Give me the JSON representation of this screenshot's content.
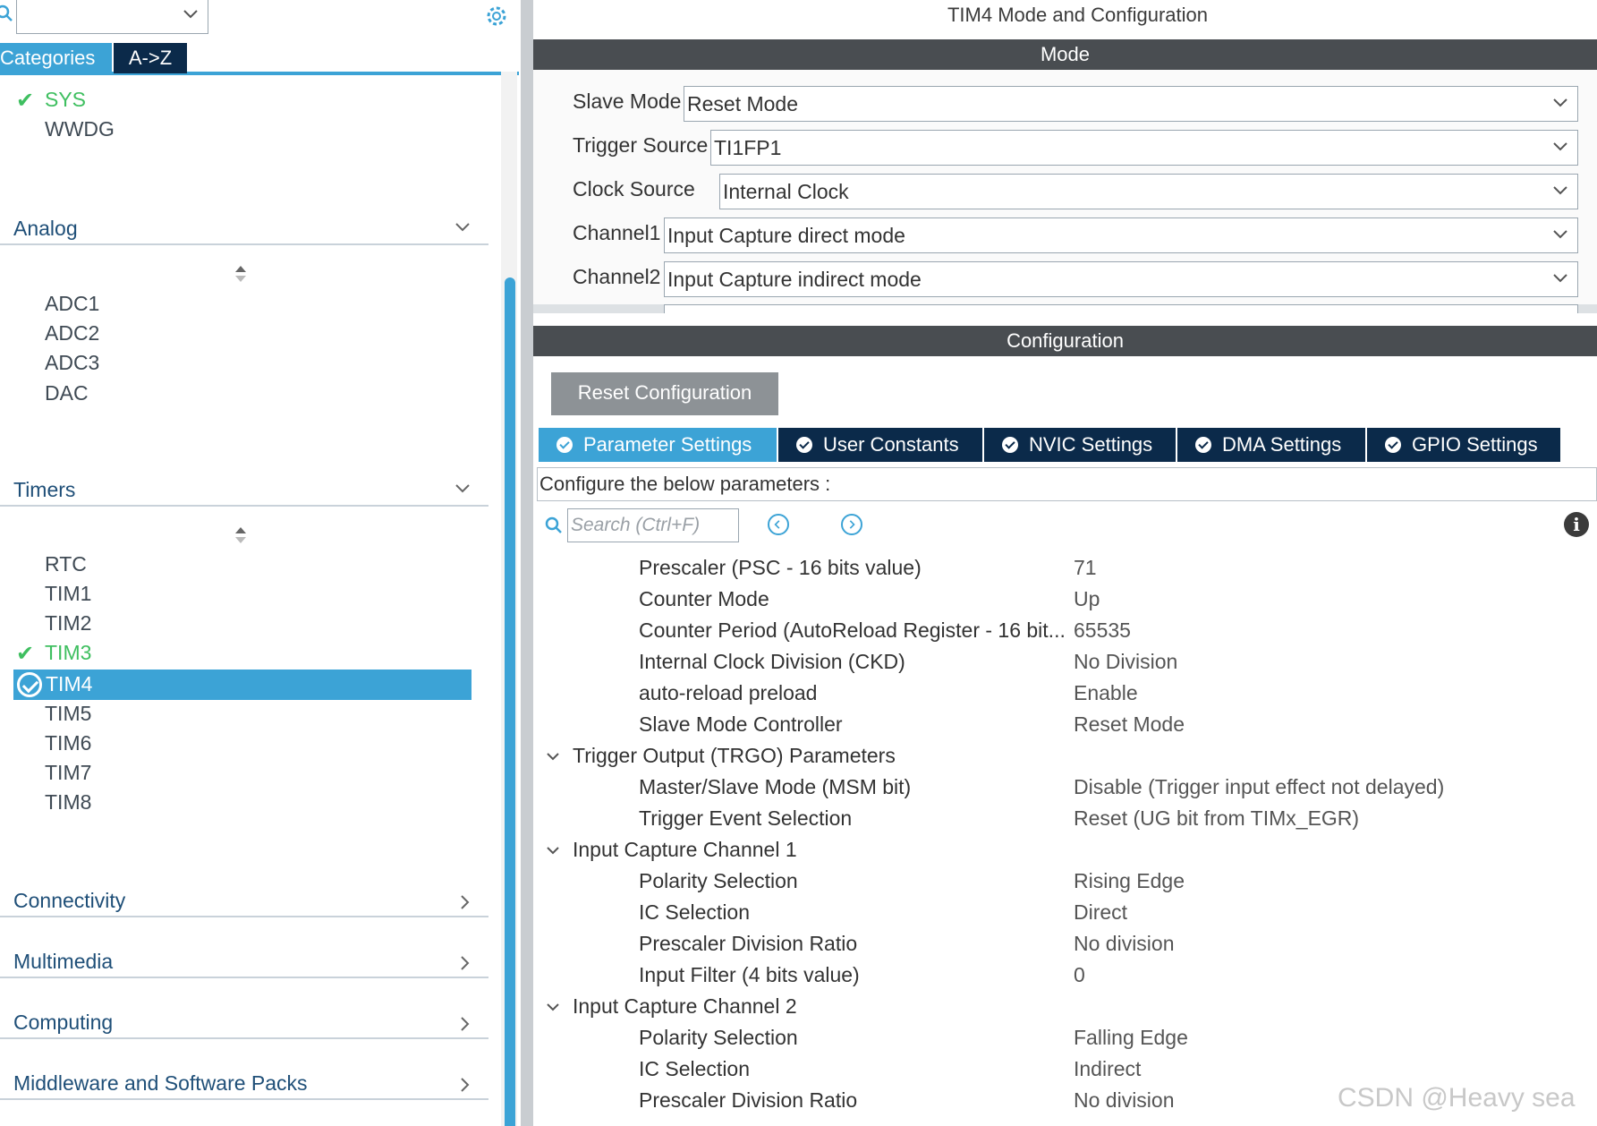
{
  "left": {
    "tabs": {
      "categories": "Categories",
      "az": "A->Z"
    },
    "system_items": [
      "SYS",
      "WWDG"
    ],
    "analog": {
      "title": "Analog",
      "items": [
        "ADC1",
        "ADC2",
        "ADC3",
        "DAC"
      ]
    },
    "timers": {
      "title": "Timers",
      "items": [
        "RTC",
        "TIM1",
        "TIM2",
        "TIM3",
        "TIM4",
        "TIM5",
        "TIM6",
        "TIM7",
        "TIM8"
      ],
      "selected": "TIM4"
    },
    "groups": [
      "Connectivity",
      "Multimedia",
      "Computing",
      "Middleware and Software Packs"
    ]
  },
  "right": {
    "title": "TIM4 Mode and Configuration",
    "mode_header": "Mode",
    "mode_rows": [
      {
        "label": "Slave Mode",
        "value": "Reset Mode"
      },
      {
        "label": "Trigger Source",
        "value": "TI1FP1"
      },
      {
        "label": "Clock Source",
        "value": "Internal Clock"
      },
      {
        "label": "Channel1",
        "value": "Input Capture direct mode"
      },
      {
        "label": "Channel2",
        "value": "Input Capture indirect mode"
      }
    ],
    "config_header": "Configuration",
    "reset_button": "Reset Configuration",
    "tabs": [
      "Parameter Settings",
      "User Constants",
      "NVIC Settings",
      "DMA Settings",
      "GPIO Settings"
    ],
    "hint": "Configure the below parameters :",
    "search_placeholder": "Search (Ctrl+F)",
    "params": [
      {
        "name": "Prescaler (PSC - 16 bits value)",
        "value": "71"
      },
      {
        "name": "Counter Mode",
        "value": "Up"
      },
      {
        "name": "Counter Period (AutoReload Register - 16 bit...",
        "value": "65535"
      },
      {
        "name": "Internal Clock Division (CKD)",
        "value": "No Division"
      },
      {
        "name": "auto-reload preload",
        "value": "Enable"
      },
      {
        "name": "Slave Mode Controller",
        "value": "Reset Mode"
      },
      {
        "group": "Trigger Output (TRGO) Parameters"
      },
      {
        "name": "Master/Slave Mode (MSM bit)",
        "value": "Disable (Trigger input effect not delayed)"
      },
      {
        "name": "Trigger Event Selection",
        "value": "Reset (UG bit from TIMx_EGR)"
      },
      {
        "group": "Input Capture Channel 1"
      },
      {
        "name": "Polarity Selection",
        "value": "Rising Edge"
      },
      {
        "name": "IC Selection",
        "value": "Direct"
      },
      {
        "name": "Prescaler Division Ratio",
        "value": "No division"
      },
      {
        "name": "Input Filter (4 bits value)",
        "value": "0"
      },
      {
        "group": "Input Capture Channel 2"
      },
      {
        "name": "Polarity Selection",
        "value": "Falling Edge"
      },
      {
        "name": "IC Selection",
        "value": "Indirect"
      },
      {
        "name": "Prescaler Division Ratio",
        "value": "No division"
      }
    ]
  },
  "watermark": "CSDN @Heavy sea",
  "colors": {
    "accent": "#3ca3d6",
    "navy": "#0b2a4a",
    "bar": "#494d51",
    "ok_green": "#3fbf60"
  }
}
